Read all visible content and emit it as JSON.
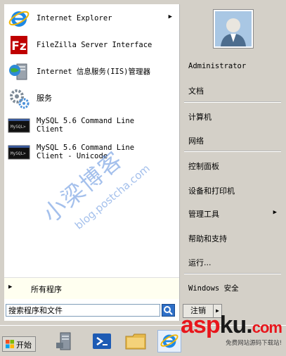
{
  "programs": [
    {
      "label": "Internet Explorer",
      "icon": "ie-icon",
      "has_submenu": true
    },
    {
      "label": "FileZilla Server Interface",
      "icon": "filezilla-icon",
      "has_submenu": false
    },
    {
      "label": "Internet 信息服务(IIS)管理器",
      "icon": "iis-manager-icon",
      "has_submenu": false
    },
    {
      "label": "服务",
      "icon": "services-gear-icon",
      "has_submenu": false
    },
    {
      "label": "MySQL 5.6 Command Line\nClient",
      "icon": "mysql-console-icon",
      "has_submenu": false
    },
    {
      "label": "MySQL 5.6 Command Line\nClient - Unicode",
      "icon": "mysql-console-icon",
      "has_submenu": false
    }
  ],
  "all_programs": {
    "label": "所有程序"
  },
  "search": {
    "placeholder": "搜索程序和文件"
  },
  "right_pane": {
    "username": "Administrator",
    "documents": "文档",
    "computer": "计算机",
    "network": "网络",
    "control_panel": "控制面板",
    "devices_printers": "设备和打印机",
    "admin_tools": "管理工具",
    "help_support": "帮助和支持",
    "run": "运行...",
    "security": "Windows 安全"
  },
  "logoff": {
    "label": "注销"
  },
  "taskbar": {
    "start_label": "开始"
  },
  "watermark": {
    "text": "小梁博客",
    "url": "blog.postcha.com"
  },
  "brand": {
    "asp": "asp",
    "ku": "ku",
    "dot": ".",
    "com": "com",
    "subtitle": "免费网站源码下载站!"
  },
  "colors": {
    "accent": "#2e6fc8",
    "brand_red": "#e8161c",
    "menu_bg": "#d4d0c8"
  }
}
